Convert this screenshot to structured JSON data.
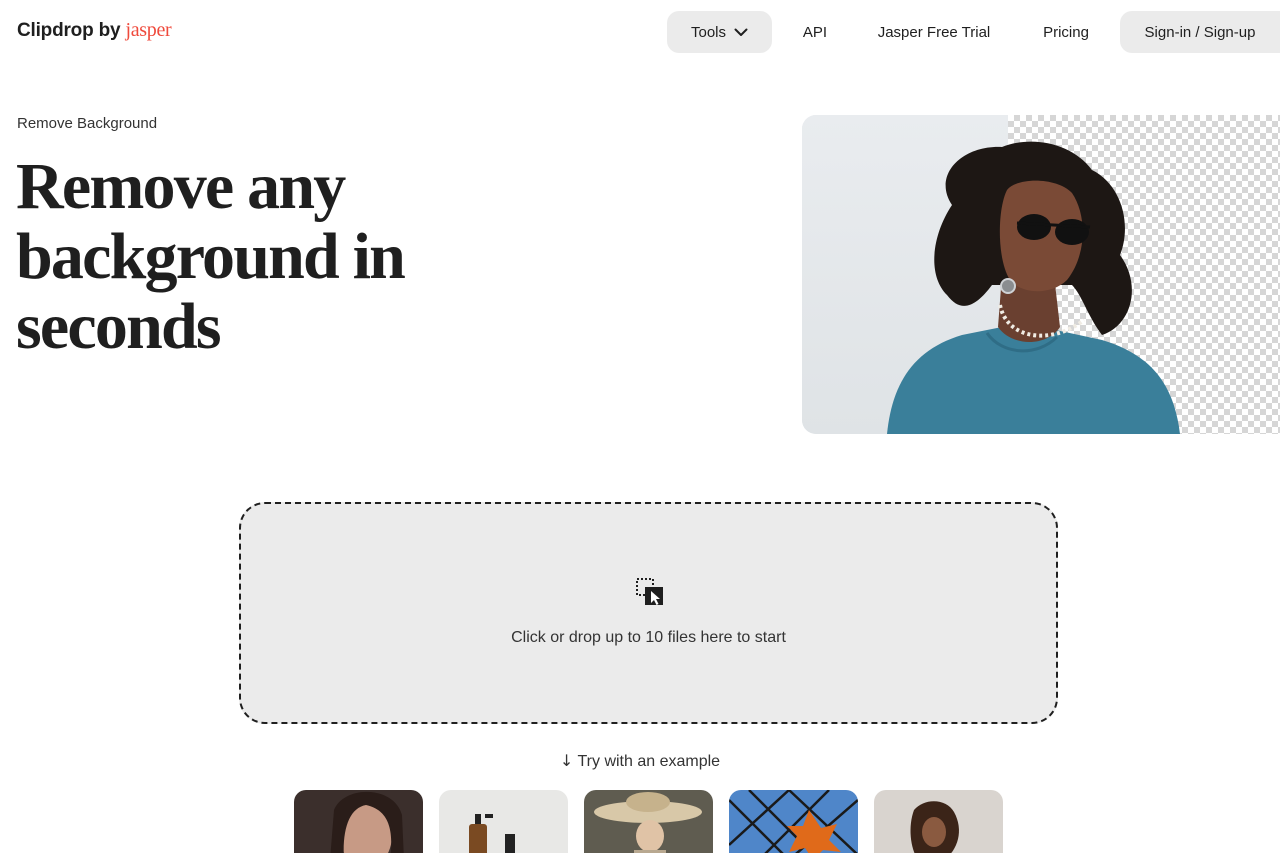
{
  "header": {
    "logo_main": "Clipdrop by",
    "logo_brand": "jasper",
    "nav": {
      "tools": "Tools",
      "api": "API",
      "trial": "Jasper Free Trial",
      "pricing": "Pricing",
      "signin": "Sign-in / Sign-up"
    }
  },
  "hero": {
    "eyebrow": "Remove Background",
    "title_line1": "Remove any",
    "title_line2": "background in",
    "title_line3": "seconds"
  },
  "upload": {
    "prompt": "Click or drop up to 10 files here to start"
  },
  "examples": {
    "arrow": "↓",
    "label": "Try with an example"
  },
  "colors": {
    "brand_accent": "#ef4a3c",
    "pill_background": "#ebebeb",
    "dropzone_background": "#ebebeb"
  }
}
